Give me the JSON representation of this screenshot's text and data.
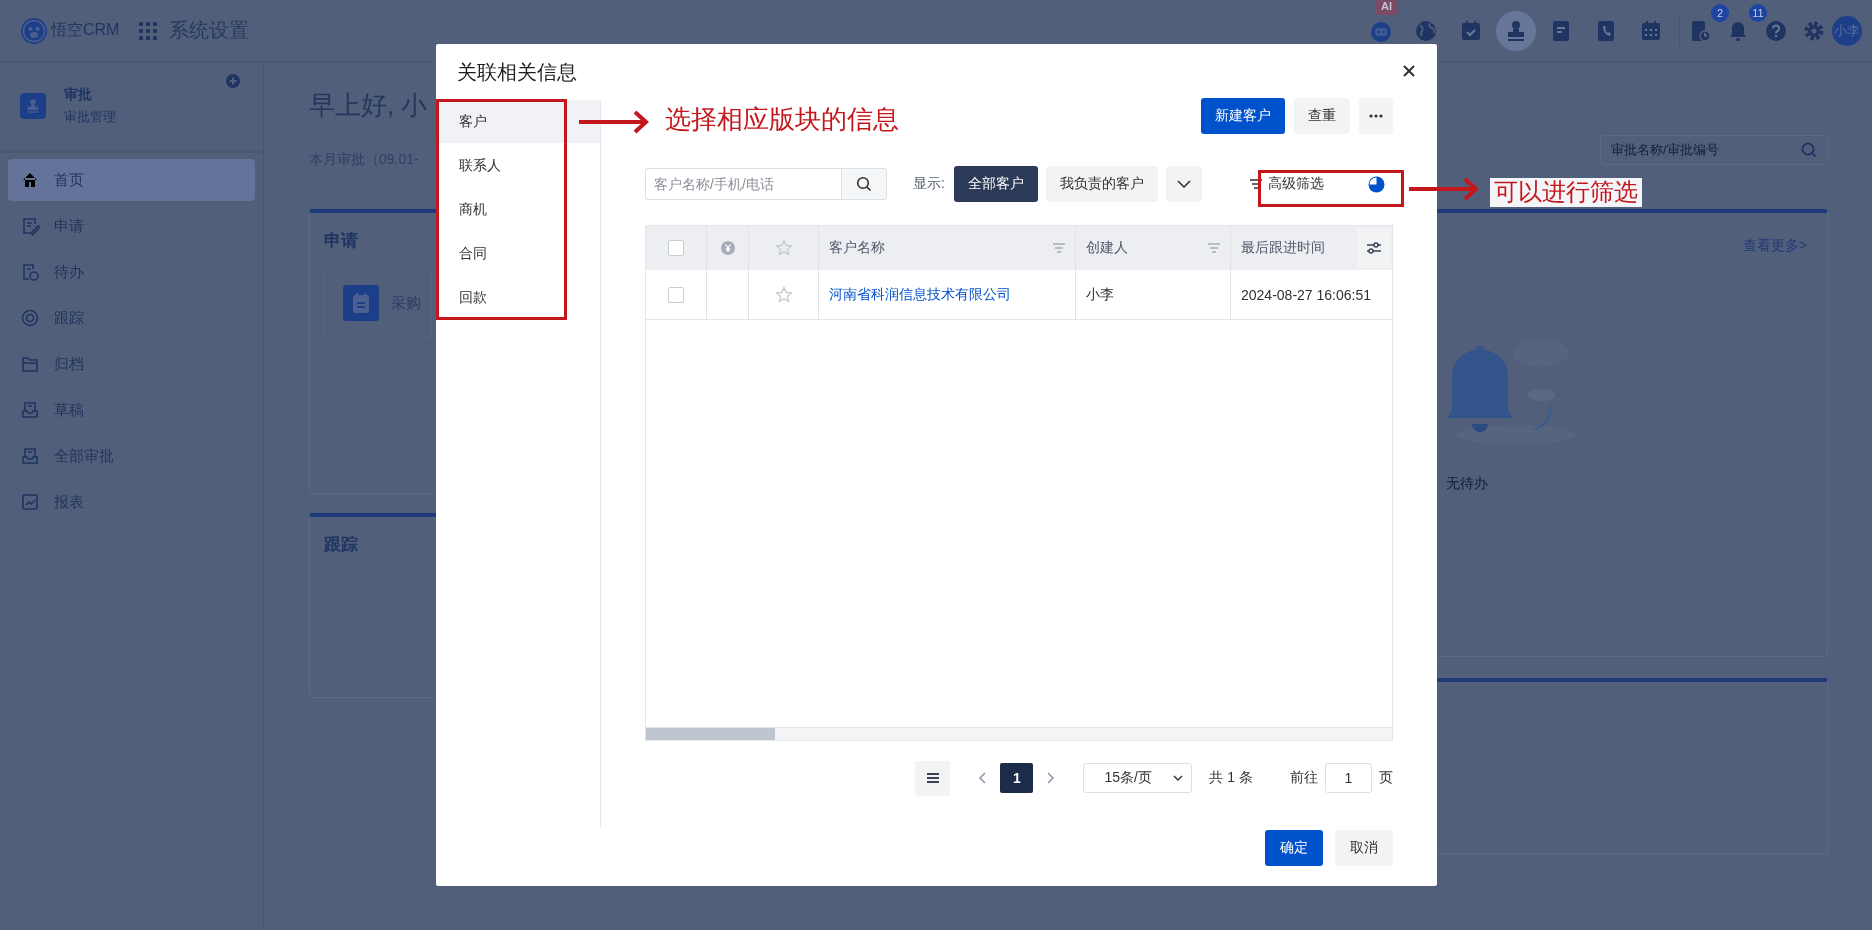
{
  "top_bar": {
    "brand": "悟空CRM",
    "section": "系统设置",
    "apps": [
      {
        "kind": "robot",
        "badge": "AI",
        "selected": false
      },
      {
        "kind": "globe",
        "selected": false
      },
      {
        "kind": "calendar-check",
        "selected": false
      },
      {
        "kind": "stamp",
        "selected": true
      },
      {
        "kind": "document",
        "selected": false
      },
      {
        "kind": "phonebook",
        "selected": false
      },
      {
        "kind": "calendar",
        "selected": false
      }
    ],
    "tools": [
      {
        "kind": "task",
        "badge": "2"
      },
      {
        "kind": "bell",
        "badge": "11"
      },
      {
        "kind": "help"
      },
      {
        "kind": "settings"
      }
    ],
    "avatar": "小李"
  },
  "sidebar": {
    "title": "审批",
    "subtitle": "审批管理",
    "items": [
      {
        "label": "首页",
        "kind": "home",
        "selected": true
      },
      {
        "label": "申请",
        "kind": "edit",
        "selected": false
      },
      {
        "label": "待办",
        "kind": "todo",
        "selected": false
      },
      {
        "label": "跟踪",
        "kind": "target",
        "selected": false
      },
      {
        "label": "归档",
        "kind": "folder",
        "selected": false
      },
      {
        "label": "草稿",
        "kind": "draft",
        "selected": false
      },
      {
        "label": "全部审批",
        "kind": "all",
        "selected": false
      },
      {
        "label": "报表",
        "kind": "chart",
        "selected": false
      }
    ]
  },
  "main": {
    "greeting": "早上好, 小",
    "period": "本月审批（09.01-",
    "search": {
      "placeholder": "审批名称/审批编号"
    },
    "cards": [
      {
        "title": "申请",
        "entry": "采购"
      },
      {
        "title": "跟踪"
      }
    ],
    "todo_card": {
      "link": "查看更多>",
      "empty_text": "无待办"
    }
  },
  "dialog": {
    "title": "关联相关信息",
    "categories": [
      {
        "label": "客户",
        "selected": true
      },
      {
        "label": "联系人",
        "selected": false
      },
      {
        "label": "商机",
        "selected": false
      },
      {
        "label": "合同",
        "selected": false
      },
      {
        "label": "回款",
        "selected": false
      }
    ],
    "primary_action": "新建客户",
    "secondary_action": "查重",
    "search": {
      "placeholder": "客户名称/手机/电话"
    },
    "scope_label": "显示:",
    "scopes": [
      {
        "label": "全部客户",
        "selected": true
      },
      {
        "label": "我负责的客户",
        "selected": false
      }
    ],
    "advanced_filter": "高级筛选",
    "table": {
      "header_checked": false,
      "columns": [
        {
          "kind": "checkbox"
        },
        {
          "kind": "money"
        },
        {
          "kind": "star"
        },
        {
          "kind": "text",
          "label": "客户名称",
          "filterable": true
        },
        {
          "kind": "text",
          "label": "创建人",
          "filterable": true
        },
        {
          "kind": "text",
          "label": "最后跟进时间",
          "filterable": false
        }
      ],
      "rows": [
        {
          "checked": false,
          "starred": false,
          "name": "河南省科润信息技术有限公司",
          "creator": "小李",
          "last_followup": "2024-08-27 16:06:51"
        }
      ]
    },
    "pagination": {
      "pages": [
        {
          "label": "1",
          "selected": true
        }
      ],
      "page_size": "15条/页",
      "total": "共 1 条",
      "goto_label": "前往",
      "goto_value": "1",
      "page_suffix": "页"
    },
    "confirm": "确定",
    "cancel": "取消"
  },
  "annotations": [
    {
      "text": "选择相应版块的信息"
    },
    {
      "text": "可以进行筛选"
    }
  ]
}
